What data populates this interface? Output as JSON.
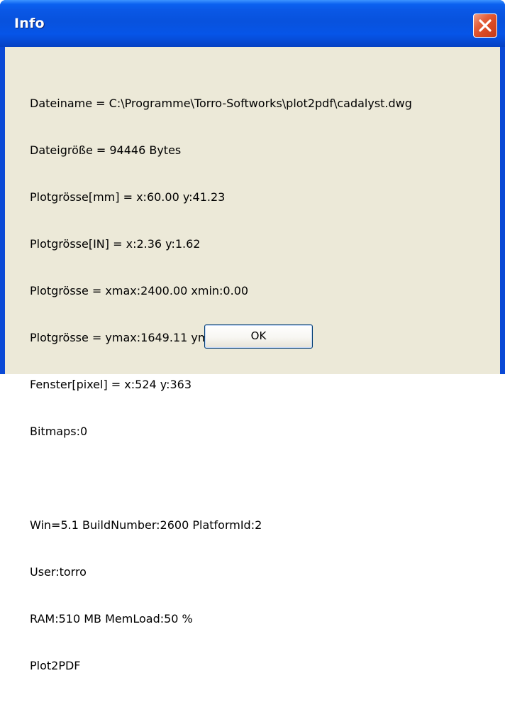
{
  "window": {
    "title": "Info",
    "close_icon": "close-x-icon"
  },
  "info": {
    "lines": [
      "Dateiname = C:\\Programme\\Torro-Softworks\\plot2pdf\\cadalyst.dwg",
      "Dateigröße = 94446 Bytes",
      "Plotgrösse[mm] = x:60.00 y:41.23",
      "Plotgrösse[IN] = x:2.36 y:1.62",
      "Plotgrösse = xmax:2400.00 xmin:0.00",
      "Plotgrösse = ymax:1649.11 ymin:0.00",
      "Fenster[pixel] = x:524 y:363",
      "Bitmaps:0"
    ],
    "system_lines": [
      "Win=5.1 BuildNumber:2600 PlatformId:2",
      "User:torro",
      "RAM:510 MB MemLoad:50 %",
      "Plot2PDF"
    ]
  },
  "buttons": {
    "ok_label": "OK"
  }
}
